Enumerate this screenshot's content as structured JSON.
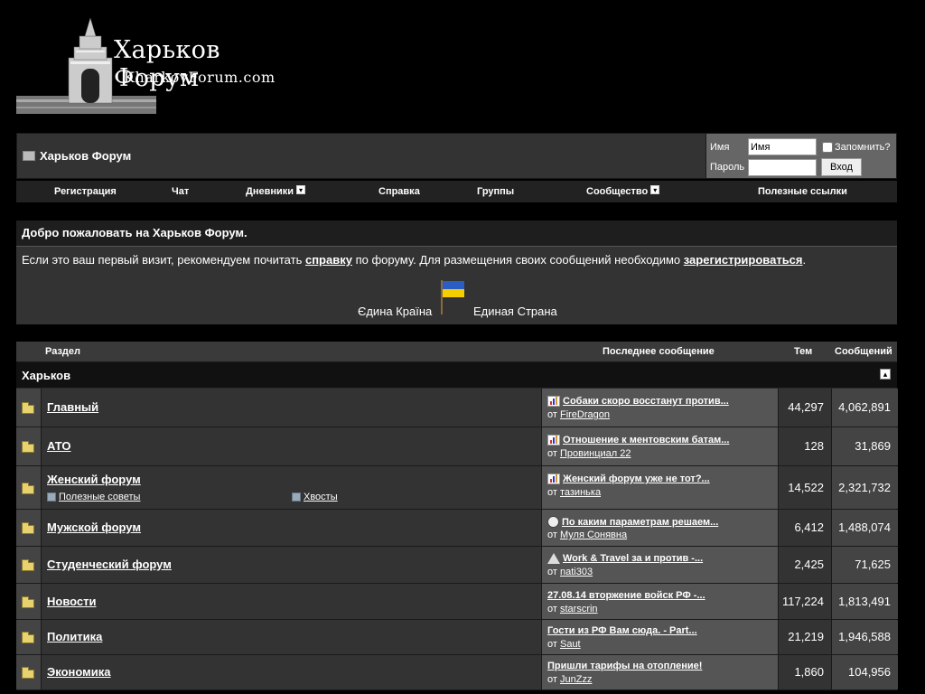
{
  "site": {
    "title": "Харьков Форум",
    "subtitle": "KharkovForum.com"
  },
  "navbar": {
    "title": "Харьков Форум"
  },
  "login": {
    "username_label": "Имя",
    "username_value": "Имя",
    "password_label": "Пароль",
    "remember_label": "Запомнить?",
    "submit_label": "Вход"
  },
  "menu": {
    "items": [
      {
        "label": "Регистрация",
        "dropdown": false
      },
      {
        "label": "Чат",
        "dropdown": false
      },
      {
        "label": "Дневники",
        "dropdown": true
      },
      {
        "label": "Справка",
        "dropdown": false
      },
      {
        "label": "Группы",
        "dropdown": false
      },
      {
        "label": "Сообщество",
        "dropdown": true
      },
      {
        "label": "Полезные ссылки",
        "dropdown": false
      }
    ]
  },
  "welcome": {
    "heading": "Добро пожаловать на Харьков Форум.",
    "text_before": "Если это ваш первый визит, рекомендуем почитать ",
    "link1": "справку",
    "text_middle": " по форуму. Для размещения своих сообщений необходимо ",
    "link2": "зарегистрироваться",
    "text_after": ".",
    "unity_left": "Єдина Країна",
    "unity_right": "Единая Страна",
    "flag_colors": [
      "#2a5ec4",
      "#f4d000"
    ]
  },
  "table": {
    "headers": {
      "section": "Раздел",
      "last_post": "Последнее сообщение",
      "threads": "Тем",
      "posts": "Сообщений"
    },
    "category": "Харьков",
    "forums": [
      {
        "name": "Главный",
        "last_title": "Собаки скоро восстанут против...",
        "last_by": "от",
        "last_user": "FireDragon",
        "icon": "chart-icon",
        "threads": "44,297",
        "posts": "4,062,891"
      },
      {
        "name": "АТО",
        "last_title": "Отношение к ментовским батам...",
        "last_by": "от",
        "last_user": "Провинциал 22",
        "icon": "chart-icon",
        "threads": "128",
        "posts": "31,869"
      },
      {
        "name": "Женский форум",
        "last_title": "Женский форум уже не тот?...",
        "last_by": "от",
        "last_user": "тазинька",
        "icon": "chart-icon",
        "threads": "14,522",
        "posts": "2,321,732",
        "subforums": [
          "Полезные советы",
          "Хвосты"
        ]
      },
      {
        "name": "Мужской форум",
        "last_title": "По каким параметрам решаем...",
        "last_by": "от",
        "last_user": "Муля Сонявна",
        "icon": "smile-icon",
        "threads": "6,412",
        "posts": "1,488,074"
      },
      {
        "name": "Студенческий форум",
        "last_title": "Work & Travel за и против -...",
        "last_by": "от",
        "last_user": "nati303",
        "icon": "warning-icon",
        "threads": "2,425",
        "posts": "71,625"
      },
      {
        "name": "Новости",
        "last_title": "27.08.14 вторжение войск РФ -...",
        "last_by": "от",
        "last_user": "starscrin",
        "icon": "",
        "threads": "117,224",
        "posts": "1,813,491"
      },
      {
        "name": "Политика",
        "last_title": "Гости из РФ Вам сюда. - Part...",
        "last_by": "от",
        "last_user": "Saut",
        "icon": "",
        "threads": "21,219",
        "posts": "1,946,588"
      },
      {
        "name": "Экономика",
        "last_title": "Пришли тарифы на отопление!",
        "last_by": "от",
        "last_user": "JunZzz",
        "icon": "",
        "threads": "1,860",
        "posts": "104,956"
      }
    ]
  }
}
